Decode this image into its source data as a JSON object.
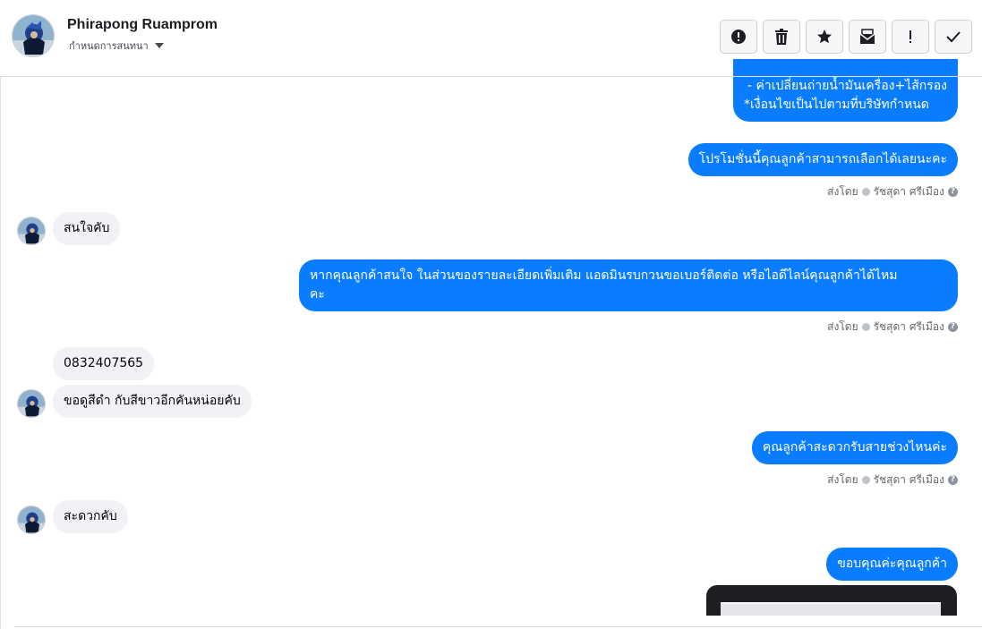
{
  "header": {
    "contact_name": "Phirapong Ruamprom",
    "conversation_label": "กำหนดการสนทนา",
    "toolbar": [
      {
        "name": "mark-spam-button",
        "icon": "alert-circle-icon"
      },
      {
        "name": "delete-button",
        "icon": "trash-icon"
      },
      {
        "name": "star-button",
        "icon": "star-icon"
      },
      {
        "name": "mark-unread-button",
        "icon": "envelope-icon"
      },
      {
        "name": "follow-up-button",
        "icon": "exclamation-icon"
      },
      {
        "name": "mark-done-button",
        "icon": "checkmark-icon"
      }
    ]
  },
  "messages": {
    "m1_line1": "- ค่าเปลี่ยนถ่ายน้ำมันเครื่อง+ไส้กรอง",
    "m1_line2": "*เงื่อนไขเป็นไปตามที่บริษัทกำหนด",
    "m2": "โปรโมชั่นนี้คุณลูกค้าสามารถเลือกได้เลยนะคะ",
    "m3": "สนใจคับ",
    "m4_line1": "หากคุณลูกค้าสนใจ ในส่วนของรายละเอียดเพิ่มเติม แอดมินรบกวนขอเบอร์ติดต่อ หรือไอดีไลน์คุณลูกค้าได้ไหม",
    "m4_line2": "คะ",
    "m5": "0832407565",
    "m6": "ขอดูสีดำ กับสีขาวอีกคันหน่อยคับ",
    "m7": "คุณลูกค้าสะดวกรับสายช่วงไหนค่ะ",
    "m8": "สะดวกคับ",
    "m9": "ขอบคุณค่ะคุณลูกค้า"
  },
  "sent_by": {
    "prefix": "ส่งโดย",
    "agent": "รัชสุดา ศรีเมือง"
  },
  "colors": {
    "outgoing_bubble": "#0a7cff",
    "incoming_bubble": "#f0f2f5"
  }
}
